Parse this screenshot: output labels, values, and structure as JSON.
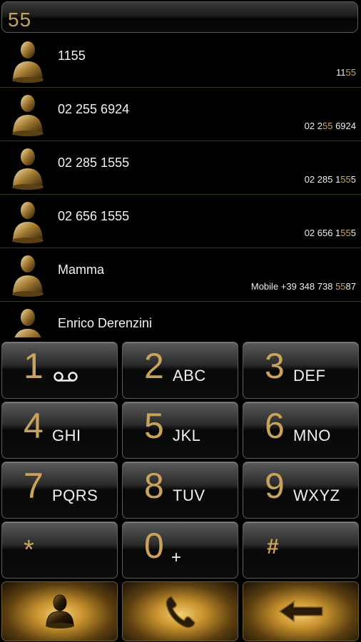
{
  "entry": {
    "value": "55"
  },
  "contacts": [
    {
      "name": "1155",
      "num_pre": "11",
      "num_hl": "55",
      "num_post": ""
    },
    {
      "name": "02 255 6924",
      "num_pre": "02 2",
      "num_hl": "55",
      "num_post": " 6924"
    },
    {
      "name": "02 285 1555",
      "num_pre": "02 285 1",
      "num_hl": "55",
      "num_post": "5"
    },
    {
      "name": "02 656 1555",
      "num_pre": "02 656 1",
      "num_hl": "55",
      "num_post": "5"
    },
    {
      "name": "Mamma",
      "num_pre": "Mobile +39 348 738 ",
      "num_hl": "55",
      "num_post": "87"
    },
    {
      "name": "Enrico Derenzini",
      "num_pre": "",
      "num_hl": "",
      "num_post": ""
    }
  ],
  "keys": {
    "k1": {
      "digit": "1",
      "letters": ""
    },
    "k2": {
      "digit": "2",
      "letters": "ABC"
    },
    "k3": {
      "digit": "3",
      "letters": "DEF"
    },
    "k4": {
      "digit": "4",
      "letters": "GHI"
    },
    "k5": {
      "digit": "5",
      "letters": "JKL"
    },
    "k6": {
      "digit": "6",
      "letters": "MNO"
    },
    "k7": {
      "digit": "7",
      "letters": "PQRS"
    },
    "k8": {
      "digit": "8",
      "letters": "TUV"
    },
    "k9": {
      "digit": "9",
      "letters": "WXYZ"
    },
    "kstar": {
      "digit": "*"
    },
    "k0": {
      "digit": "0",
      "letters": "+"
    },
    "khash": {
      "digit": "#"
    }
  },
  "icons": {
    "contact": "person-icon",
    "voicemail": "voicemail-icon",
    "call": "phone-handset-icon",
    "backspace": "backspace-arrow-icon"
  },
  "colors": {
    "accent": "#c9a35c",
    "background": "#000000",
    "text": "#f2f2f2"
  }
}
